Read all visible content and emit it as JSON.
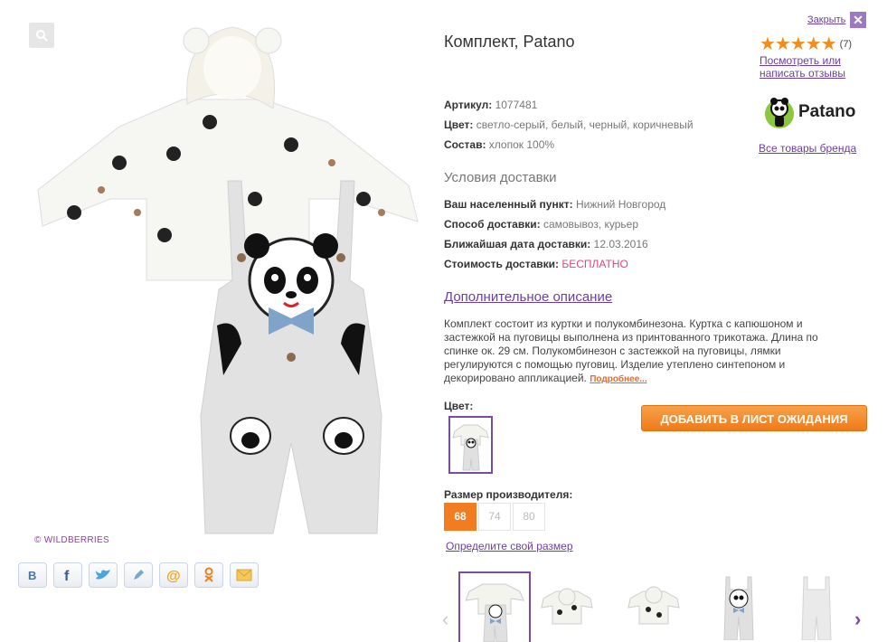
{
  "close_label": "Закрыть",
  "title": "Комплект, Patano",
  "rating": {
    "stars": "★★★★★",
    "count": "(7)",
    "value": 5
  },
  "reviews_link": "Посмотреть или написать отзывы",
  "brand": {
    "logo_text": "Patano",
    "link": "Все товары бренда"
  },
  "attributes": [
    {
      "label": "Артикул:",
      "value": "1077481"
    },
    {
      "label": "Цвет:",
      "value": "светло-серый, белый, черный, коричневый"
    },
    {
      "label": "Состав:",
      "value": "хлопок 100%"
    }
  ],
  "delivery": {
    "title": "Условия доставки",
    "rows": [
      {
        "label": "Ваш населенный пункт:",
        "value": "Нижний Новгород"
      },
      {
        "label": "Способ доставки:",
        "value": "самовывоз, курьер"
      },
      {
        "label": "Ближайшая дата доставки:",
        "value": "12.03.2016"
      },
      {
        "label": "Стоимость доставки:",
        "value": "БЕСПЛАТНО"
      }
    ]
  },
  "description": {
    "title": "Дополнительное описание",
    "text": "Комплект состоит из куртки и полукомбинезона. Куртка с капюшоном и застежкой на пуговицы выполнена из принтованного трикотажа. Длина по спинке ок. 29 см. Полукомбинезон с застежкой на пуговицы, лямки регулируются с помощью пуговиц. Изделие утеплено синтепоном и декорировано аппликацией.",
    "more": "Подробнее..."
  },
  "color_label": "Цвет:",
  "wait_button": "ДОБАВИТЬ В ЛИСТ ОЖИДАНИЯ",
  "size_label": "Размер производителя:",
  "sizes": [
    "68",
    "74",
    "80"
  ],
  "selected_size": "68",
  "size_link": "Определите свой размер",
  "watermark": "© WILDBERRIES",
  "social": [
    "vk-icon",
    "facebook-icon",
    "twitter-icon",
    "livejournal-icon",
    "mail-icon",
    "odnoklassniki-icon",
    "email-icon"
  ],
  "colors": {
    "accent": "#7b4aa3",
    "orange": "#f27d21",
    "link": "#6b3fa0",
    "free": "#e0467a",
    "star": "#f28c1a"
  }
}
